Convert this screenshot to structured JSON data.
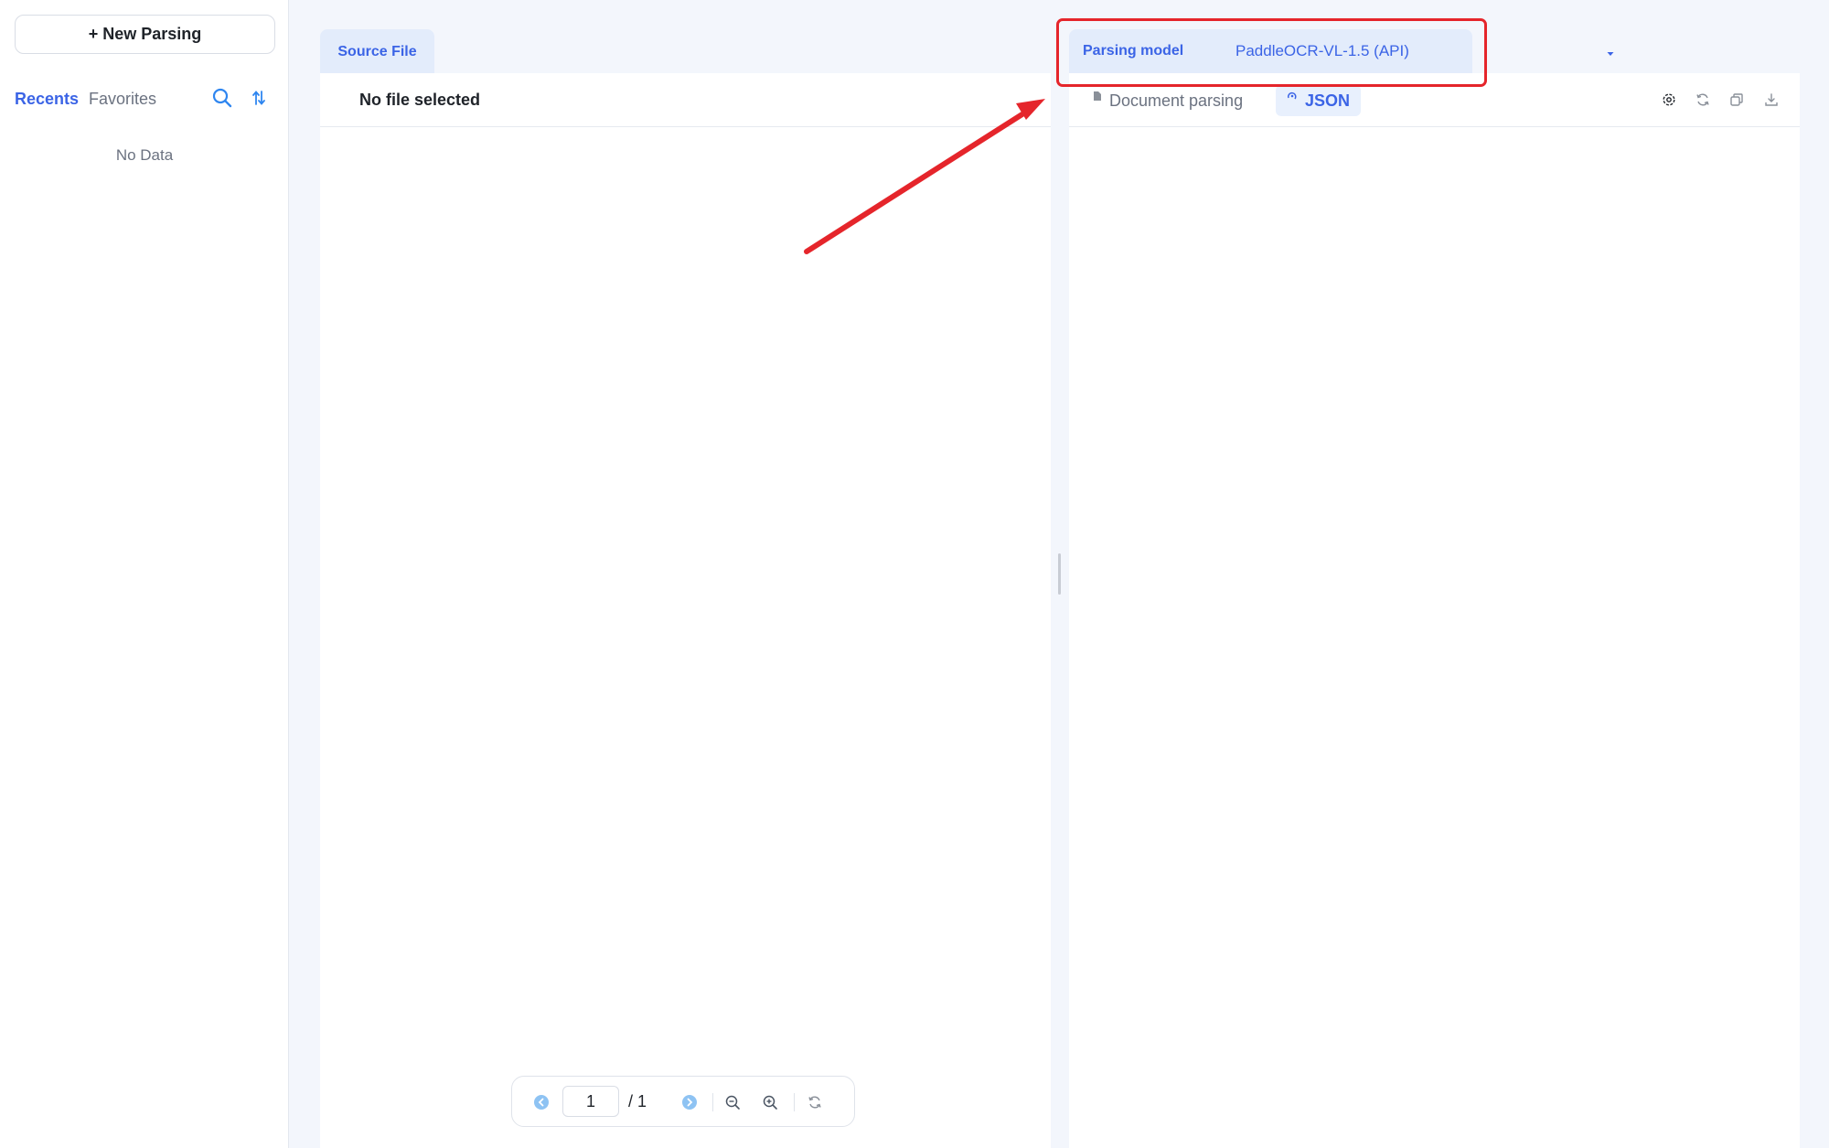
{
  "sidebar": {
    "new_button": "+ New Parsing",
    "tabs": [
      {
        "label": "Recents",
        "active": true
      },
      {
        "label": "Favorites",
        "active": false
      }
    ],
    "icons": [
      "search-icon",
      "sort-icon"
    ],
    "empty_text": "No Data"
  },
  "source": {
    "tab_label": "Source File",
    "header": "No file selected",
    "pager": {
      "current_page": "1",
      "total": "/ 1",
      "icons": [
        "prev-page-icon",
        "next-page-icon",
        "zoom-out-icon",
        "zoom-in-icon",
        "reset-icon"
      ]
    }
  },
  "results": {
    "model_label": "Parsing model",
    "model_value": "PaddleOCR-VL-1.5 (API)",
    "tabs": [
      {
        "label": "Document parsing",
        "active": false,
        "icon": "document-icon"
      },
      {
        "label": "JSON",
        "active": true,
        "icon": "json-icon"
      }
    ],
    "tools": [
      "settings-icon",
      "refresh-icon",
      "copy-icon",
      "download-icon"
    ]
  },
  "annotation": {
    "color": "#e5252b"
  },
  "colors": {
    "accent": "#3b64e6",
    "tab_bg": "#e3ecfb",
    "background": "#f3f6fc"
  }
}
